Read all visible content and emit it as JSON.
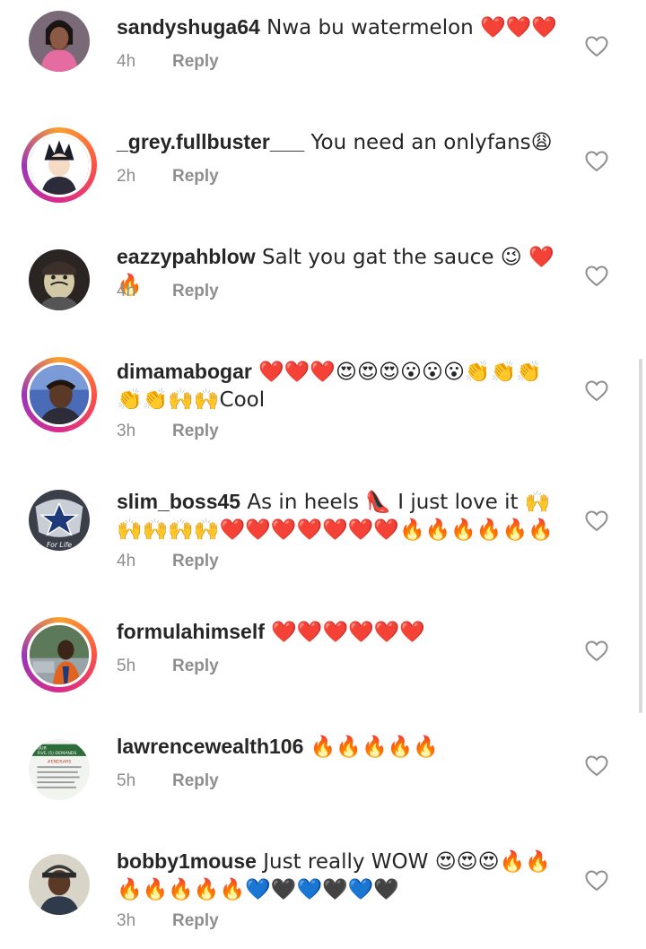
{
  "comments": [
    {
      "username": "sandyshuga64",
      "text": " Nwa bu watermelon ❤️❤️❤️",
      "time": "4h",
      "reply": "Reply"
    },
    {
      "username": "_grey.fullbuster___",
      "text": " You need an onlyfans😩",
      "time": "2h",
      "reply": "Reply"
    },
    {
      "username": "eazzypahblow",
      "text": " Salt you gat the sauce 😉 ❤️🔥",
      "time": "4h",
      "reply": "Reply"
    },
    {
      "username": "dimamabogar",
      "text": " ❤️❤️❤️😍😍😍😮😮😮👏👏👏👏👏🙌🙌Cool",
      "time": "3h",
      "reply": "Reply"
    },
    {
      "username": "slim_boss45",
      "text": " As in heels 👠 I just love it 🙌🙌🙌🙌🙌❤️❤️❤️❤️❤️❤️❤️🔥🔥🔥🔥🔥🔥",
      "time": "4h",
      "reply": "Reply"
    },
    {
      "username": "formulahimself",
      "text": " ❤️❤️❤️❤️❤️❤️",
      "time": "5h",
      "reply": "Reply"
    },
    {
      "username": "lawrencewealth106",
      "text": " 🔥🔥🔥🔥🔥",
      "time": "5h",
      "reply": "Reply"
    },
    {
      "username": "bobby1mouse",
      "text": " Just really WOW 😍😍😍🔥🔥🔥🔥🔥🔥🔥💙🖤💙🖤💙🖤",
      "time": "3h",
      "reply": "Reply"
    }
  ],
  "avatar_badge": {
    "line1": "OUR",
    "line2": "FIVE (5) DEMANDS",
    "line3": "#ENDSARS"
  },
  "avatar_caption": "For Life"
}
